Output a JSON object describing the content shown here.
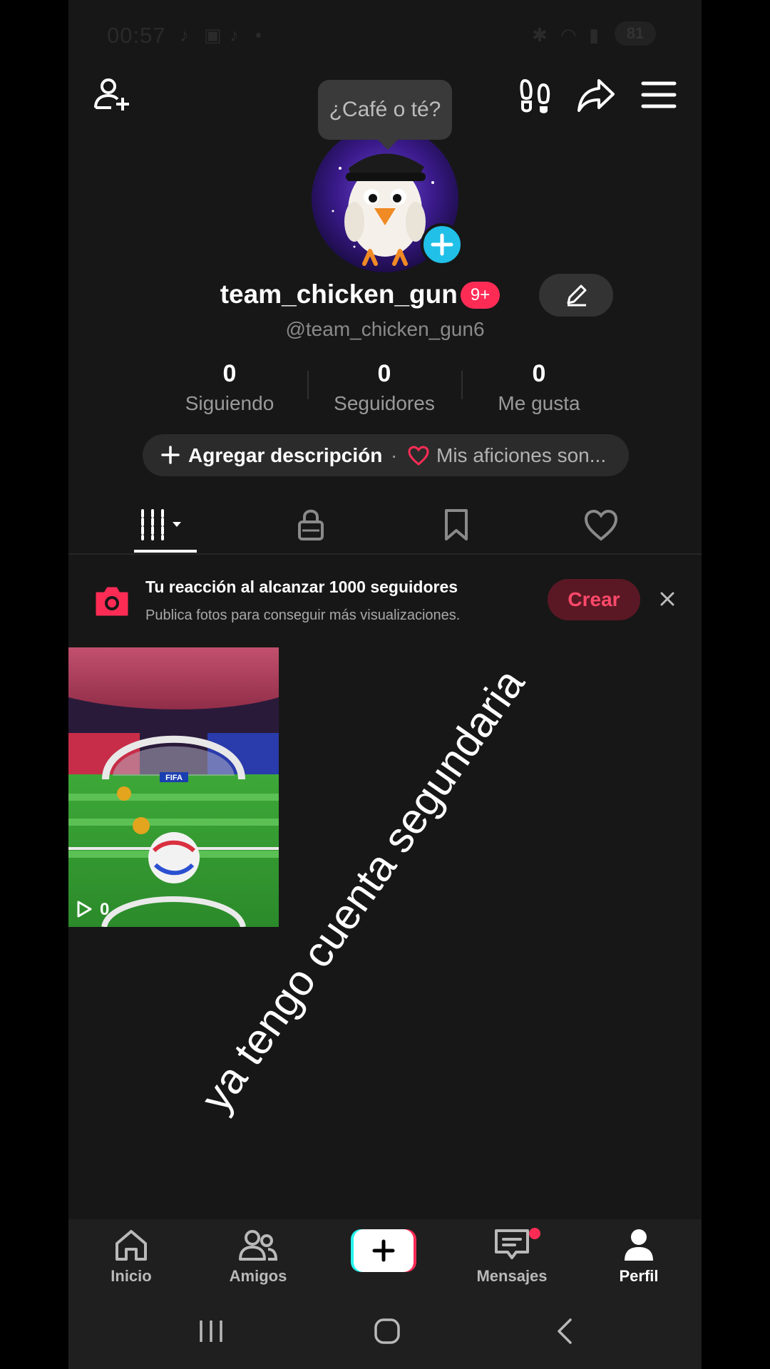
{
  "status_bar": {
    "time": "00:57",
    "battery": "81"
  },
  "header": {
    "tooltip": "¿Café o té?"
  },
  "profile": {
    "username": "team_chicken_gun",
    "notif_badge": "9+",
    "handle": "@team_chicken_gun6",
    "stats": [
      {
        "value": "0",
        "label": "Siguiendo"
      },
      {
        "value": "0",
        "label": "Seguidores"
      },
      {
        "value": "0",
        "label": "Me gusta"
      }
    ],
    "add_description": "Agregar descripción",
    "separator": "·",
    "hobbies": "Mis aficiones son..."
  },
  "banner": {
    "title": "Tu reacción al alcanzar 1000 seguidores",
    "subtitle": "Publica fotos para conseguir más visualizaciones.",
    "button": "Crear"
  },
  "video": {
    "views": "0",
    "logo_text": "FIFA"
  },
  "overlay_text": "ya tengo cuenta segundaria",
  "bottom_nav": [
    {
      "label": "Inicio"
    },
    {
      "label": "Amigos"
    },
    {
      "label": ""
    },
    {
      "label": "Mensajes"
    },
    {
      "label": "Perfil"
    }
  ],
  "colors": {
    "accent": "#fe2c55",
    "cyan": "#20c0e8",
    "background": "#171717"
  }
}
